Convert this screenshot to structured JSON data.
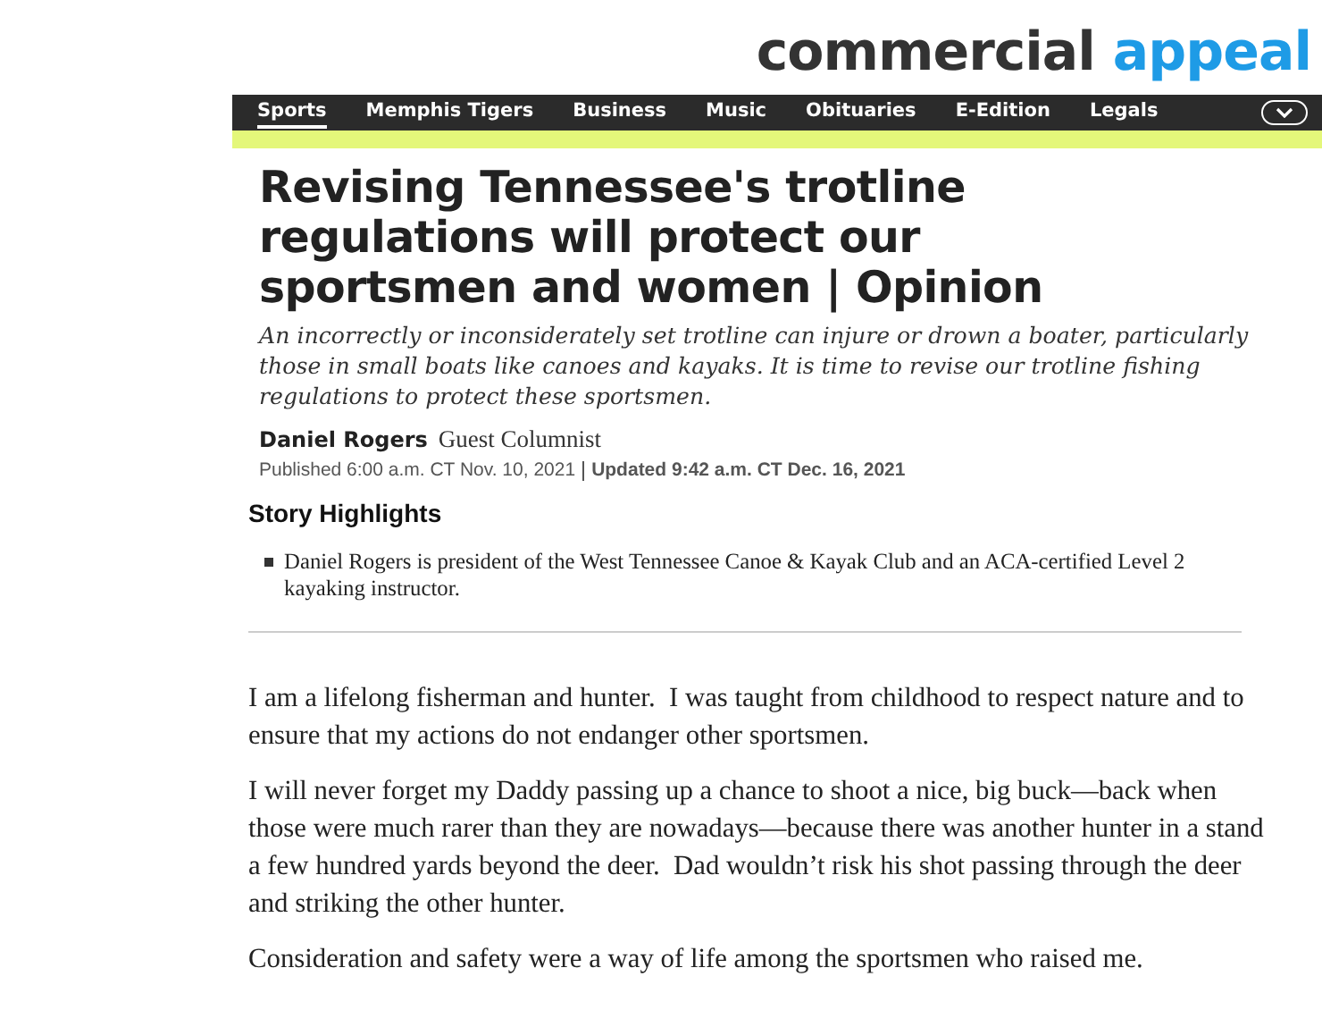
{
  "logo": {
    "dark": "commercial",
    "accent": "appeal"
  },
  "nav": {
    "items": [
      {
        "label": "Sports",
        "selected": true
      },
      {
        "label": "Memphis Tigers",
        "selected": false
      },
      {
        "label": "Business",
        "selected": false
      },
      {
        "label": "Music",
        "selected": false
      },
      {
        "label": "Obituaries",
        "selected": false
      },
      {
        "label": "E-Edition",
        "selected": false
      },
      {
        "label": "Legals",
        "selected": false
      }
    ]
  },
  "article": {
    "headline": "Revising Tennessee's trotline regulations will protect our sportsmen and women | Opinion",
    "summary": "An incorrectly or inconsiderately set trotline can injure or drown a boater, particularly those in small boats like canoes and kayaks. It is time to revise our trotline fishing regulations to protect these sportsmen.",
    "author": "Daniel Rogers",
    "author_role": "Guest Columnist",
    "published": "Published 6:00 a.m. CT Nov. 10, 2021",
    "updated": "Updated 9:42 a.m. CT Dec. 16, 2021",
    "highlights_title": "Story Highlights",
    "highlights": [
      "Daniel Rogers is president of the West Tennessee Canoe & Kayak Club and an ACA-certified Level 2 kayaking instructor."
    ],
    "paragraphs": [
      "I am a lifelong fisherman and hunter.  I was taught from childhood to respect nature and to ensure that my actions do not endanger other sportsmen.",
      "I will never forget my Daddy passing up a chance to shoot a nice, big buck—back when those were much rarer than they are nowadays—because there was another hunter in a stand a few hundred yards beyond the deer.  Dad wouldn’t risk his shot passing through the deer and striking the other hunter.",
      "Consideration and safety were a way of life among the sportsmen who raised me."
    ]
  }
}
